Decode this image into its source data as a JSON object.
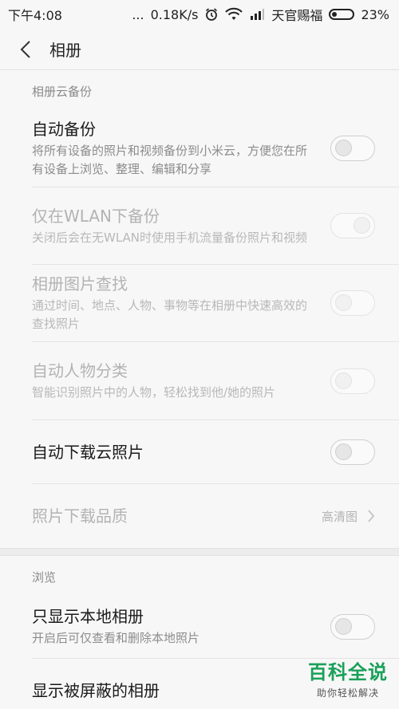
{
  "status_bar": {
    "time": "下午4:08",
    "dots": "...",
    "speed": "0.18K/s",
    "carrier": "天官赐福",
    "battery": "23%"
  },
  "header": {
    "title": "相册"
  },
  "section1": {
    "label": "相册云备份",
    "items": [
      {
        "title": "自动备份",
        "desc": "将所有设备的照片和视频备份到小米云，方便您在所有设备上浏览、整理、编辑和分享"
      },
      {
        "title": "仅在WLAN下备份",
        "desc": "关闭后会在无WLAN时使用手机流量备份照片和视频"
      },
      {
        "title": "相册图片查找",
        "desc": "通过时间、地点、人物、事物等在相册中快速高效的查找照片"
      },
      {
        "title": "自动人物分类",
        "desc": "智能识别照片中的人物，轻松找到他/她的照片"
      },
      {
        "title": "自动下载云照片"
      },
      {
        "title": "照片下载品质",
        "value": "高清图"
      }
    ]
  },
  "section2": {
    "label": "浏览",
    "items": [
      {
        "title": "只显示本地相册",
        "desc": "开启后可仅查看和删除本地照片"
      },
      {
        "title": "显示被屏蔽的相册"
      }
    ]
  },
  "watermark": {
    "big": "百科全说",
    "small": "助你轻松解决"
  }
}
